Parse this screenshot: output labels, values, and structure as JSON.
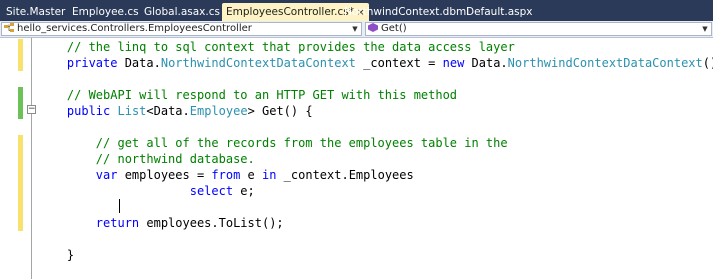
{
  "tabs": [
    {
      "label": "Site.Master"
    },
    {
      "label": "Employee.cs"
    },
    {
      "label": "Global.asax.cs"
    },
    {
      "label": "EmployeesController.cs*",
      "active": true
    },
    {
      "label": "NorthwindContext.dbml"
    },
    {
      "label": "Default.aspx"
    }
  ],
  "close_glyph": "×",
  "navbar": {
    "class_combo": "hello_services.Controllers.EmployeesController",
    "member_combo": "Get()"
  },
  "code": {
    "l1": {
      "indent": "    ",
      "comment": "// the linq to sql context that provides the data access layer"
    },
    "l2": {
      "indent": "    ",
      "kw1": "private",
      "t1": " Data.",
      "ty1": "NorthwindContextDataContext",
      "t2": " _context = ",
      "kw2": "new",
      "t3": " Data.",
      "ty2": "NorthwindContextDataContext",
      "t4": "();"
    },
    "l4": {
      "indent": "    ",
      "comment": "// WebAPI will respond to an HTTP GET with this method"
    },
    "l5": {
      "indent": "    ",
      "kw1": "public",
      "t1": " ",
      "ty1": "List",
      "t2": "<Data.",
      "ty2": "Employee",
      "t3": "> Get() {"
    },
    "l7": {
      "indent": "        ",
      "comment": "// get all of the records from the employees table in the"
    },
    "l8": {
      "indent": "        ",
      "comment": "// northwind database."
    },
    "l9": {
      "indent": "        ",
      "kw1": "var",
      "t1": " employees = ",
      "kw2": "from",
      "t2": " e ",
      "kw3": "in",
      "t3": " _context.Employees"
    },
    "l10": {
      "indent": "                     ",
      "kw1": "select",
      "t1": " e;"
    },
    "l12": {
      "indent": "        ",
      "kw1": "return",
      "t1": " employees.ToList();"
    },
    "l14": {
      "indent": "    ",
      "t1": "}"
    }
  },
  "colors": {
    "tabbar": "#2b3a58",
    "active_tab": "#fdf3c5",
    "comment": "#008000",
    "keyword": "#0000ff",
    "type": "#2b91af",
    "saved_change": "#6ac259",
    "unsaved_change": "#f7e26b"
  }
}
